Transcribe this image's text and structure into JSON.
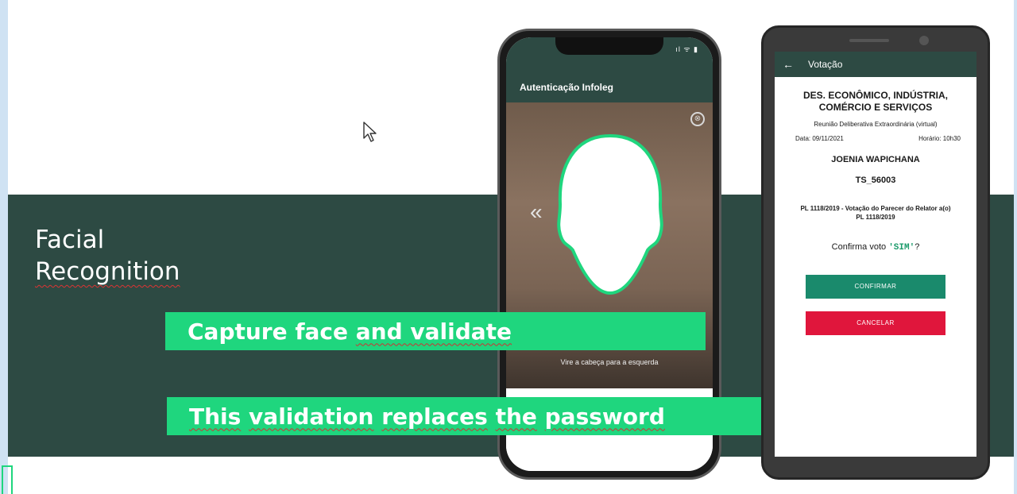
{
  "slide": {
    "title_line1": "Facial",
    "title_line2": "Recognition",
    "banner1": {
      "part1": "Capture face ",
      "part2": "and validate"
    },
    "banner2": {
      "w1": "This",
      "w2": "validation",
      "w3": "replaces",
      "w4": "the",
      "w5": "password"
    }
  },
  "phone1": {
    "status": "ıl ᯤ ▮",
    "title": "Autenticação Infoleg",
    "close_icon": "⊗",
    "chevron_icon": "«",
    "hint": "Vire a cabeça para a esquerda"
  },
  "phone2": {
    "back_icon": "←",
    "appbar_title": "Votação",
    "committee_line1": "DES. ECONÔMICO, INDÚSTRIA,",
    "committee_line2": "COMÉRCIO E SERVIÇOS",
    "meeting": "Reunião Deliberativa Extraordinária (virtual)",
    "date": "Data: 09/11/2021",
    "time": "Horário: 10h30",
    "name": "JOENIA WAPICHANA",
    "code": "TS_56003",
    "pl_line1": "PL 1118/2019 -  Votação do Parecer do Relator a(o)",
    "pl_line2": "PL 1118/2019",
    "confirm_prefix": "Confirma voto ",
    "confirm_vote": "'SIM'",
    "confirm_suffix": "?",
    "confirm_button": "CONFIRMAR",
    "cancel_button": "CANCELAR"
  },
  "colors": {
    "band": "#2d4a43",
    "accent_green": "#1fd67e",
    "confirm": "#1a8a6c",
    "cancel": "#e0163c"
  }
}
